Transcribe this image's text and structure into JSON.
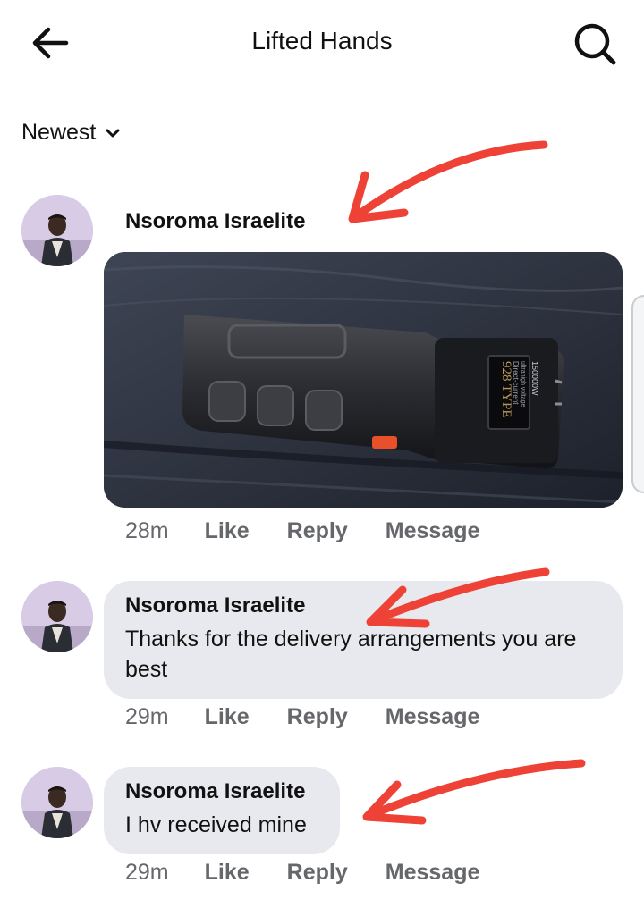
{
  "header": {
    "title": "Lifted Hands",
    "back_icon": "arrow-left-icon",
    "search_icon": "search-icon"
  },
  "sort": {
    "label": "Newest",
    "icon": "chevron-down-icon"
  },
  "colors": {
    "annotation_arrow": "#ef4237",
    "bubble": "#e8e9ee",
    "meta_text": "#65676b"
  },
  "comments": [
    {
      "author": "Nsoroma Israelite",
      "photo_label": {
        "model": "928 TYPE",
        "rating": "150000W",
        "line1": "Direct-current",
        "line2": "ultrahigh voltage"
      },
      "time": "28m",
      "like": "Like",
      "reply": "Reply",
      "message": "Message"
    },
    {
      "author": "Nsoroma Israelite",
      "text": "Thanks for the delivery arrangements you are best",
      "time": "29m",
      "like": "Like",
      "reply": "Reply",
      "message": "Message"
    },
    {
      "author": "Nsoroma Israelite",
      "text": "I hv received mine",
      "time": "29m",
      "like": "Like",
      "reply": "Reply",
      "message": "Message"
    }
  ]
}
